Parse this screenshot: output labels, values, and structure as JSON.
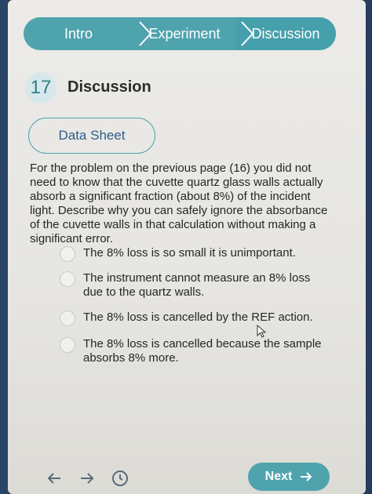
{
  "steps": [
    {
      "label": "Intro"
    },
    {
      "label": "Experiment"
    },
    {
      "label": "Discussion"
    }
  ],
  "question": {
    "number": "17",
    "title": "Discussion",
    "data_sheet_label": "Data Sheet",
    "text": "For the problem on the previous page (16) you did not need to know that the cuvette quartz glass walls actually absorb a significant fraction (about 8%) of the incident light. Describe why you can safely ignore the absorbance of the cuvette walls in that calculation without making a significant error."
  },
  "options": [
    {
      "label": "The 8% loss is so small it is unimportant."
    },
    {
      "label": "The instrument cannot measure an 8% loss due to the quartz walls."
    },
    {
      "label": "The 8% loss is cancelled by the REF action."
    },
    {
      "label": "The 8% loss is cancelled because the sample absorbs 8% more."
    }
  ],
  "footer": {
    "next_label": "Next"
  },
  "colors": {
    "accent": "#4fa3ad",
    "background": "#ecebe8"
  }
}
